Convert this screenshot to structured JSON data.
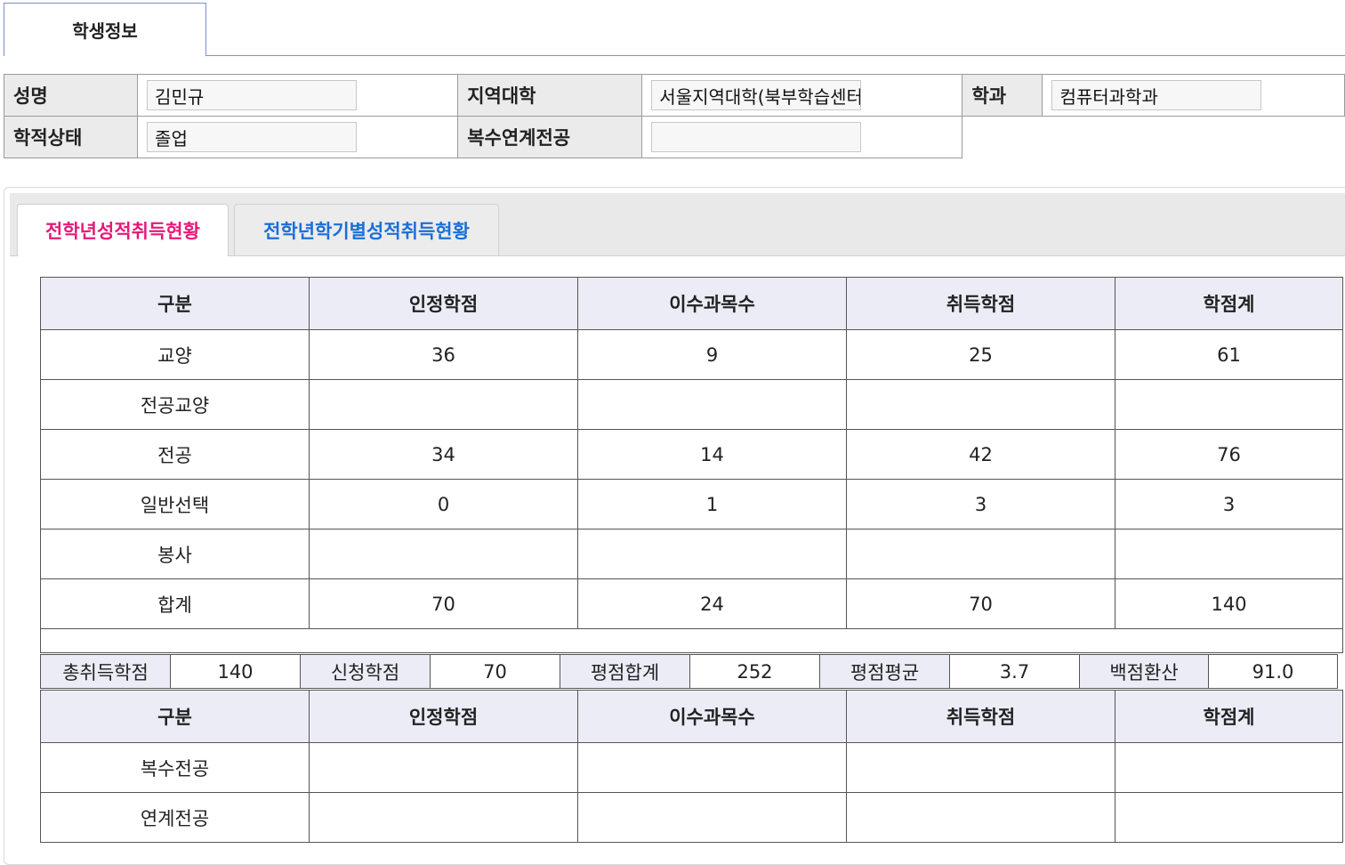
{
  "top_tab": {
    "label": "학생정보"
  },
  "student_info": {
    "name_label": "성명",
    "name_value": "김민규",
    "region_label": "지역대학",
    "region_value": "서울지역대학(북부학습센터)",
    "dept_label": "학과",
    "dept_value": "컴퓨터과학과",
    "status_label": "학적상태",
    "status_value": "졸업",
    "double_major_label": "복수연계전공",
    "double_major_value": ""
  },
  "panel_tabs": [
    {
      "label": "전학년성적취득현황",
      "active": true
    },
    {
      "label": "전학년학기별성적취득현황",
      "active": false
    }
  ],
  "credit_table": {
    "headers": [
      "구분",
      "인정학점",
      "이수과목수",
      "취득학점",
      "학점계"
    ],
    "rows": [
      [
        "교양",
        "36",
        "9",
        "25",
        "61"
      ],
      [
        "전공교양",
        "",
        "",
        "",
        ""
      ],
      [
        "전공",
        "34",
        "14",
        "42",
        "76"
      ],
      [
        "일반선택",
        "0",
        "1",
        "3",
        "3"
      ],
      [
        "봉사",
        "",
        "",
        "",
        ""
      ],
      [
        "합계",
        "70",
        "24",
        "70",
        "140"
      ]
    ]
  },
  "summary": {
    "total_label": "총취득학점",
    "total_value": "140",
    "applied_label": "신청학점",
    "applied_value": "70",
    "gp_sum_label": "평점합계",
    "gp_sum_value": "252",
    "gpa_label": "평점평균",
    "gpa_value": "3.7",
    "percent_label": "백점환산",
    "percent_value": "91.0"
  },
  "major_table": {
    "headers": [
      "구분",
      "인정학점",
      "이수과목수",
      "취득학점",
      "학점계"
    ],
    "rows": [
      [
        "복수전공",
        "",
        "",
        "",
        ""
      ],
      [
        "연계전공",
        "",
        "",
        "",
        ""
      ]
    ]
  },
  "colors": {
    "active_tab": "#e6197a",
    "inactive_tab": "#1a6fd8",
    "header_bg": "#ececf7"
  }
}
